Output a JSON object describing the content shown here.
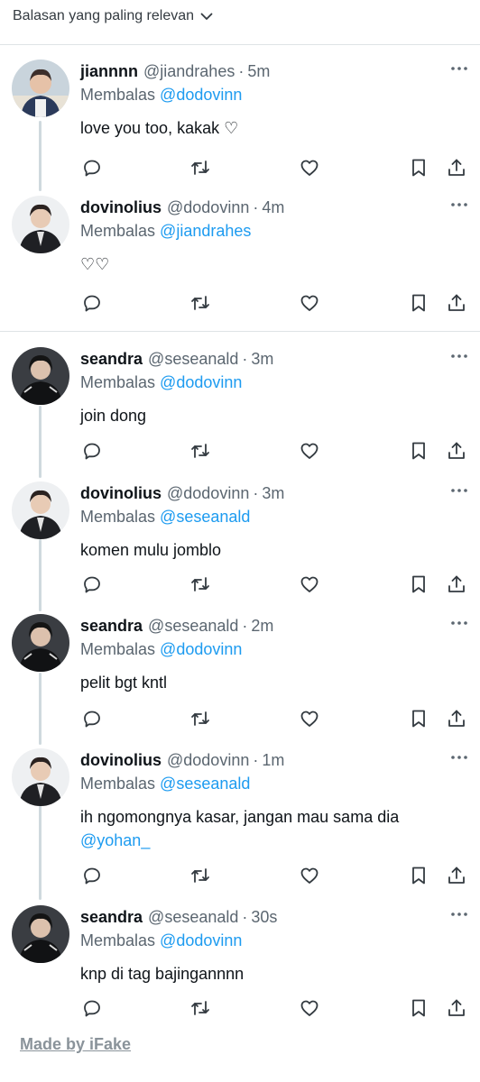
{
  "header": {
    "sort_label": "Balasan yang paling relevan"
  },
  "accent_color": "#1d9bf0",
  "replying_prefix": "Membalas",
  "dot": "·",
  "tweets": [
    {
      "name": "jiannnn",
      "handle": "@jiandrahes",
      "time": "5m",
      "reply_to": "@dodovinn",
      "text": "love you too, kakak ♡",
      "text_mention": ""
    },
    {
      "name": "dovinolius",
      "handle": "@dodovinn",
      "time": "4m",
      "reply_to": "@jiandrahes",
      "text": "♡♡",
      "text_mention": ""
    },
    {
      "name": "seandra",
      "handle": "@seseanald",
      "time": "3m",
      "reply_to": "@dodovinn",
      "text": "join dong",
      "text_mention": ""
    },
    {
      "name": "dovinolius",
      "handle": "@dodovinn",
      "time": "3m",
      "reply_to": "@seseanald",
      "text": "komen mulu jomblo",
      "text_mention": ""
    },
    {
      "name": "seandra",
      "handle": "@seseanald",
      "time": "2m",
      "reply_to": "@dodovinn",
      "text": "pelit bgt kntl",
      "text_mention": ""
    },
    {
      "name": "dovinolius",
      "handle": "@dodovinn",
      "time": "1m",
      "reply_to": "@seseanald",
      "text": "ih ngomongnya kasar, jangan mau sama dia",
      "text_mention": "@yohan_"
    },
    {
      "name": "seandra",
      "handle": "@seseanald",
      "time": "30s",
      "reply_to": "@dodovinn",
      "text": "knp di tag bajingannnn",
      "text_mention": ""
    }
  ],
  "icons": [
    "chevron-down-icon",
    "more-icon",
    "reply-icon",
    "retweet-icon",
    "like-icon",
    "bookmark-icon",
    "share-icon"
  ],
  "watermark": "Made by iFake"
}
